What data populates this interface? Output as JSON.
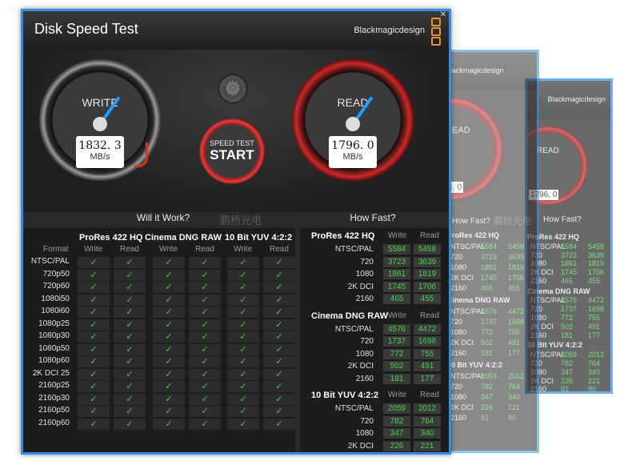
{
  "app": {
    "title": "Disk Speed Test",
    "brand": "Blackmagicdesign",
    "close": "✕"
  },
  "write_gauge": {
    "label": "WRITE",
    "value": "1832. 3",
    "unit": "MB/s",
    "needle_color": "#1e9cff"
  },
  "read_gauge": {
    "label": "READ",
    "value": "1796. 0",
    "unit": "MB/s",
    "accent": "#c92a2a"
  },
  "start": {
    "line1": "SPEED TEST",
    "line2": "START"
  },
  "settings_icon": "gear-icon",
  "sections": {
    "will_it_work": "Will it Work?",
    "how_fast": "How Fast?"
  },
  "watermark": "鹏桥光电",
  "will": {
    "format_label": "Format",
    "codecs": [
      "ProRes 422 HQ",
      "Cinema DNG RAW",
      "10 Bit YUV 4:2:2"
    ],
    "subheads": [
      "Write",
      "Read"
    ],
    "formats": [
      "NTSC/PAL",
      "720p50",
      "720p60",
      "1080i50",
      "1080i60",
      "1080p25",
      "1080p30",
      "1080p50",
      "1080p60",
      "2K DCI 25",
      "2160p25",
      "2160p30",
      "2160p50",
      "2160p60"
    ],
    "check": "✓"
  },
  "how": {
    "subheads": [
      "Write",
      "Read"
    ],
    "groups": [
      {
        "name": "ProRes 422 HQ",
        "rows": [
          {
            "label": "NTSC/PAL",
            "write": "5584",
            "read": "5458"
          },
          {
            "label": "720",
            "write": "3723",
            "read": "3639"
          },
          {
            "label": "1080",
            "write": "1861",
            "read": "1819"
          },
          {
            "label": "2K DCI",
            "write": "1745",
            "read": "1706"
          },
          {
            "label": "2160",
            "write": "465",
            "read": "455"
          }
        ]
      },
      {
        "name": "Cinema DNG RAW",
        "rows": [
          {
            "label": "NTSC/PAL",
            "write": "4576",
            "read": "4472"
          },
          {
            "label": "720",
            "write": "1737",
            "read": "1698"
          },
          {
            "label": "1080",
            "write": "772",
            "read": "755"
          },
          {
            "label": "2K DCI",
            "write": "502",
            "read": "491"
          },
          {
            "label": "2160",
            "write": "181",
            "read": "177"
          }
        ]
      },
      {
        "name": "10 Bit YUV 4:2:2",
        "rows": [
          {
            "label": "NTSC/PAL",
            "write": "2059",
            "read": "2012"
          },
          {
            "label": "720",
            "write": "782",
            "read": "764"
          },
          {
            "label": "1080",
            "write": "347",
            "read": "340"
          },
          {
            "label": "2K DCI",
            "write": "226",
            "read": "221"
          },
          {
            "label": "2160",
            "write": "81",
            "read": "80"
          }
        ]
      }
    ]
  },
  "ghost1": {
    "brand": "lackmagicdesign",
    "gauge_label": "EAD",
    "value": "6. 0",
    "section": "How Fast?",
    "watermark": "鹏桥光电"
  },
  "ghost2": {
    "brand": "Blackmagicdesign",
    "gauge_label": "READ",
    "value": "1796. 0",
    "unit": "MB/s",
    "section": "How Fast?"
  }
}
